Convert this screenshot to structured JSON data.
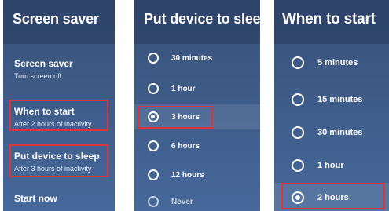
{
  "screen_saver_panel": {
    "title": "Screen saver",
    "items": [
      {
        "title": "Screen saver",
        "subtitle": "Turn screen off"
      },
      {
        "title": "When to start",
        "subtitle": "After 2 hours of inactivity"
      },
      {
        "title": "Put device to sleep",
        "subtitle": "After 3 hours of inactivity"
      },
      {
        "title": "Start now",
        "subtitle": ""
      }
    ]
  },
  "sleep_panel": {
    "title": "Put device to sleep",
    "options": [
      {
        "label": "30 minutes",
        "selected": false
      },
      {
        "label": "1 hour",
        "selected": false
      },
      {
        "label": "3 hours",
        "selected": true
      },
      {
        "label": "6 hours",
        "selected": false
      },
      {
        "label": "12 hours",
        "selected": false
      },
      {
        "label": "Never",
        "selected": false
      }
    ]
  },
  "start_panel": {
    "title": "When to start",
    "options": [
      {
        "label": "5 minutes",
        "selected": false
      },
      {
        "label": "15 minutes",
        "selected": false
      },
      {
        "label": "30 minutes",
        "selected": false
      },
      {
        "label": "1 hour",
        "selected": false
      },
      {
        "label": "2 hours",
        "selected": true
      }
    ]
  },
  "colors": {
    "highlight_border": "#d8353c",
    "panel_background": "#3d5a86",
    "text": "#ffffff"
  }
}
